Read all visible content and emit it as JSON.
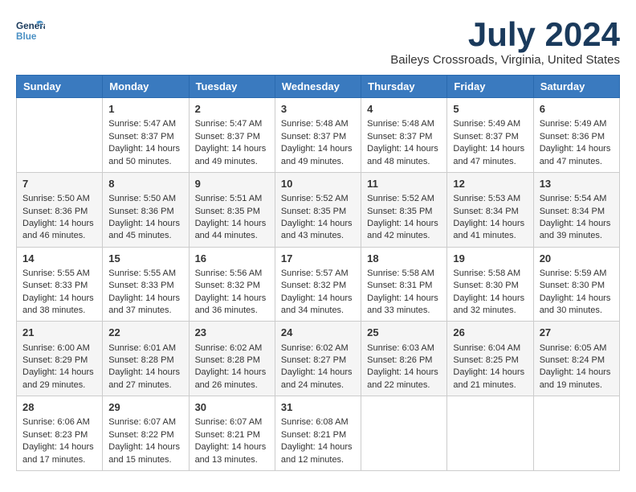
{
  "header": {
    "logo_general": "General",
    "logo_blue": "Blue",
    "month": "July 2024",
    "location": "Baileys Crossroads, Virginia, United States"
  },
  "weekdays": [
    "Sunday",
    "Monday",
    "Tuesday",
    "Wednesday",
    "Thursday",
    "Friday",
    "Saturday"
  ],
  "weeks": [
    [
      {
        "day": "",
        "sunrise": "",
        "sunset": "",
        "daylight": ""
      },
      {
        "day": "1",
        "sunrise": "Sunrise: 5:47 AM",
        "sunset": "Sunset: 8:37 PM",
        "daylight": "Daylight: 14 hours and 50 minutes."
      },
      {
        "day": "2",
        "sunrise": "Sunrise: 5:47 AM",
        "sunset": "Sunset: 8:37 PM",
        "daylight": "Daylight: 14 hours and 49 minutes."
      },
      {
        "day": "3",
        "sunrise": "Sunrise: 5:48 AM",
        "sunset": "Sunset: 8:37 PM",
        "daylight": "Daylight: 14 hours and 49 minutes."
      },
      {
        "day": "4",
        "sunrise": "Sunrise: 5:48 AM",
        "sunset": "Sunset: 8:37 PM",
        "daylight": "Daylight: 14 hours and 48 minutes."
      },
      {
        "day": "5",
        "sunrise": "Sunrise: 5:49 AM",
        "sunset": "Sunset: 8:37 PM",
        "daylight": "Daylight: 14 hours and 47 minutes."
      },
      {
        "day": "6",
        "sunrise": "Sunrise: 5:49 AM",
        "sunset": "Sunset: 8:36 PM",
        "daylight": "Daylight: 14 hours and 47 minutes."
      }
    ],
    [
      {
        "day": "7",
        "sunrise": "Sunrise: 5:50 AM",
        "sunset": "Sunset: 8:36 PM",
        "daylight": "Daylight: 14 hours and 46 minutes."
      },
      {
        "day": "8",
        "sunrise": "Sunrise: 5:50 AM",
        "sunset": "Sunset: 8:36 PM",
        "daylight": "Daylight: 14 hours and 45 minutes."
      },
      {
        "day": "9",
        "sunrise": "Sunrise: 5:51 AM",
        "sunset": "Sunset: 8:35 PM",
        "daylight": "Daylight: 14 hours and 44 minutes."
      },
      {
        "day": "10",
        "sunrise": "Sunrise: 5:52 AM",
        "sunset": "Sunset: 8:35 PM",
        "daylight": "Daylight: 14 hours and 43 minutes."
      },
      {
        "day": "11",
        "sunrise": "Sunrise: 5:52 AM",
        "sunset": "Sunset: 8:35 PM",
        "daylight": "Daylight: 14 hours and 42 minutes."
      },
      {
        "day": "12",
        "sunrise": "Sunrise: 5:53 AM",
        "sunset": "Sunset: 8:34 PM",
        "daylight": "Daylight: 14 hours and 41 minutes."
      },
      {
        "day": "13",
        "sunrise": "Sunrise: 5:54 AM",
        "sunset": "Sunset: 8:34 PM",
        "daylight": "Daylight: 14 hours and 39 minutes."
      }
    ],
    [
      {
        "day": "14",
        "sunrise": "Sunrise: 5:55 AM",
        "sunset": "Sunset: 8:33 PM",
        "daylight": "Daylight: 14 hours and 38 minutes."
      },
      {
        "day": "15",
        "sunrise": "Sunrise: 5:55 AM",
        "sunset": "Sunset: 8:33 PM",
        "daylight": "Daylight: 14 hours and 37 minutes."
      },
      {
        "day": "16",
        "sunrise": "Sunrise: 5:56 AM",
        "sunset": "Sunset: 8:32 PM",
        "daylight": "Daylight: 14 hours and 36 minutes."
      },
      {
        "day": "17",
        "sunrise": "Sunrise: 5:57 AM",
        "sunset": "Sunset: 8:32 PM",
        "daylight": "Daylight: 14 hours and 34 minutes."
      },
      {
        "day": "18",
        "sunrise": "Sunrise: 5:58 AM",
        "sunset": "Sunset: 8:31 PM",
        "daylight": "Daylight: 14 hours and 33 minutes."
      },
      {
        "day": "19",
        "sunrise": "Sunrise: 5:58 AM",
        "sunset": "Sunset: 8:30 PM",
        "daylight": "Daylight: 14 hours and 32 minutes."
      },
      {
        "day": "20",
        "sunrise": "Sunrise: 5:59 AM",
        "sunset": "Sunset: 8:30 PM",
        "daylight": "Daylight: 14 hours and 30 minutes."
      }
    ],
    [
      {
        "day": "21",
        "sunrise": "Sunrise: 6:00 AM",
        "sunset": "Sunset: 8:29 PM",
        "daylight": "Daylight: 14 hours and 29 minutes."
      },
      {
        "day": "22",
        "sunrise": "Sunrise: 6:01 AM",
        "sunset": "Sunset: 8:28 PM",
        "daylight": "Daylight: 14 hours and 27 minutes."
      },
      {
        "day": "23",
        "sunrise": "Sunrise: 6:02 AM",
        "sunset": "Sunset: 8:28 PM",
        "daylight": "Daylight: 14 hours and 26 minutes."
      },
      {
        "day": "24",
        "sunrise": "Sunrise: 6:02 AM",
        "sunset": "Sunset: 8:27 PM",
        "daylight": "Daylight: 14 hours and 24 minutes."
      },
      {
        "day": "25",
        "sunrise": "Sunrise: 6:03 AM",
        "sunset": "Sunset: 8:26 PM",
        "daylight": "Daylight: 14 hours and 22 minutes."
      },
      {
        "day": "26",
        "sunrise": "Sunrise: 6:04 AM",
        "sunset": "Sunset: 8:25 PM",
        "daylight": "Daylight: 14 hours and 21 minutes."
      },
      {
        "day": "27",
        "sunrise": "Sunrise: 6:05 AM",
        "sunset": "Sunset: 8:24 PM",
        "daylight": "Daylight: 14 hours and 19 minutes."
      }
    ],
    [
      {
        "day": "28",
        "sunrise": "Sunrise: 6:06 AM",
        "sunset": "Sunset: 8:23 PM",
        "daylight": "Daylight: 14 hours and 17 minutes."
      },
      {
        "day": "29",
        "sunrise": "Sunrise: 6:07 AM",
        "sunset": "Sunset: 8:22 PM",
        "daylight": "Daylight: 14 hours and 15 minutes."
      },
      {
        "day": "30",
        "sunrise": "Sunrise: 6:07 AM",
        "sunset": "Sunset: 8:21 PM",
        "daylight": "Daylight: 14 hours and 13 minutes."
      },
      {
        "day": "31",
        "sunrise": "Sunrise: 6:08 AM",
        "sunset": "Sunset: 8:21 PM",
        "daylight": "Daylight: 14 hours and 12 minutes."
      },
      {
        "day": "",
        "sunrise": "",
        "sunset": "",
        "daylight": ""
      },
      {
        "day": "",
        "sunrise": "",
        "sunset": "",
        "daylight": ""
      },
      {
        "day": "",
        "sunrise": "",
        "sunset": "",
        "daylight": ""
      }
    ]
  ]
}
